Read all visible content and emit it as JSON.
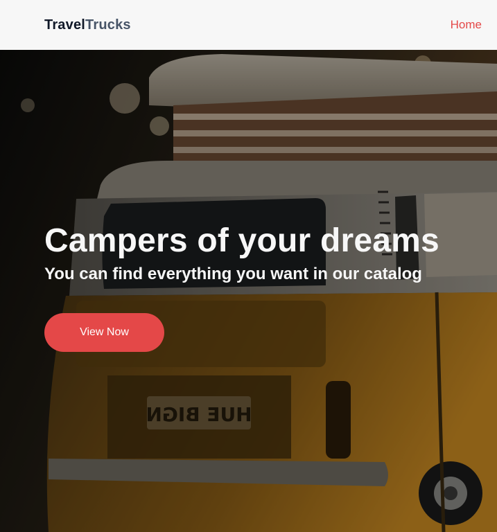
{
  "header": {
    "logo_part1": "Travel",
    "logo_part2": "Trucks",
    "nav_home": "Home"
  },
  "hero": {
    "title": "Campers of your dreams",
    "subtitle": "You can find everything you want in our catalog",
    "cta_label": "View Now",
    "plate_text": "HUE BIGN"
  },
  "colors": {
    "accent": "#e44848",
    "header_bg": "#f7f7f7",
    "logo_dark": "#101828",
    "logo_gray": "#475467"
  }
}
